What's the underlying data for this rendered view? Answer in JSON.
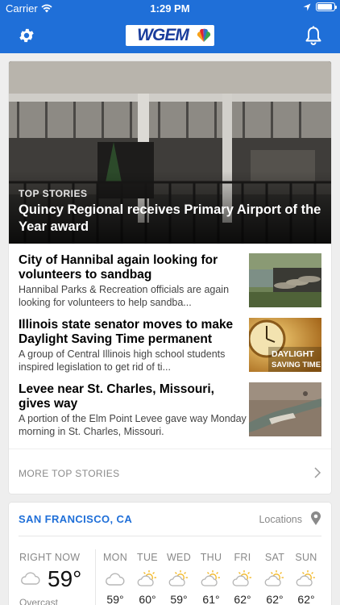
{
  "status_bar": {
    "carrier": "Carrier",
    "time": "1:29 PM"
  },
  "nav": {
    "logo_text": "WGEM",
    "colors": {
      "bar": "#1f6fd8"
    }
  },
  "top_story": {
    "kicker": "TOP STORIES",
    "title": "Quincy Regional receives Primary Airport of the Year award"
  },
  "stories": [
    {
      "title": "City of Hannibal again looking for volunteers to sandbag",
      "summary": "Hannibal Parks & Recreation officials are again looking for volunteers to help sandba..."
    },
    {
      "title": "Illinois state senator moves to make Daylight Saving Time permanent",
      "summary": "A group of Central Illinois high school students inspired legislation to get rid of  ti...",
      "thumb_text_1": "DAYLIGHT",
      "thumb_text_2": "SAVING TIME"
    },
    {
      "title": "Levee near St. Charles, Missouri, gives way",
      "summary": "A portion of the Elm Point Levee gave way Monday morning in St. Charles, Missouri."
    }
  ],
  "more_top_stories": "MORE TOP STORIES",
  "weather": {
    "city": "SAN FRANCISCO, CA",
    "locations_label": "Locations",
    "right_now": {
      "label": "RIGHT NOW",
      "temp": "59°",
      "condition": "Overcast",
      "icon": "cloud-icon"
    },
    "forecast": [
      {
        "day": "MON",
        "temp": "59°",
        "icon": "cloud-icon"
      },
      {
        "day": "TUE",
        "temp": "60°",
        "icon": "partly-sunny-icon"
      },
      {
        "day": "WED",
        "temp": "59°",
        "icon": "partly-sunny-icon"
      },
      {
        "day": "THU",
        "temp": "61°",
        "icon": "partly-sunny-icon"
      },
      {
        "day": "FRI",
        "temp": "62°",
        "icon": "partly-sunny-icon"
      },
      {
        "day": "SAT",
        "temp": "62°",
        "icon": "partly-sunny-icon"
      },
      {
        "day": "SUN",
        "temp": "62°",
        "icon": "partly-sunny-icon"
      }
    ]
  }
}
